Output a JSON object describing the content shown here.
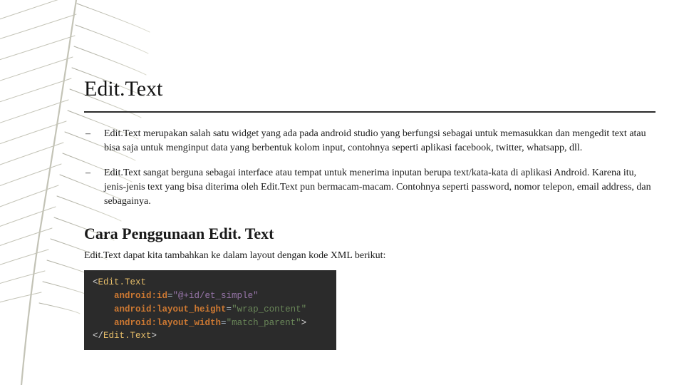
{
  "title": "Edit.Text",
  "bullets": [
    "Edit.Text merupakan salah satu widget yang ada pada android studio yang berfungsi sebagai untuk memasukkan dan mengedit text atau bisa saja untuk menginput data yang berbentuk kolom input, contohnya seperti aplikasi facebook, twitter, whatsapp, dll.",
    "Edit.Text sangat berguna sebagai interface atau tempat untuk menerima inputan berupa text/kata-kata di aplikasi Android. Karena itu, jenis-jenis text yang bisa diterima oleh Edit.Text pun bermacam-macam. Contohnya seperti password, nomor telepon, email address, dan sebagainya."
  ],
  "subheading": "Cara Penggunaan Edit. Text",
  "intro": "Edit.Text dapat kita tambahkan ke dalam layout dengan kode XML berikut:",
  "code": {
    "tag_open": "Edit.Text",
    "attr_id_name": "android:id",
    "attr_id_val": "\"@+id/et_simple\"",
    "attr_h_name": "android:layout_height",
    "attr_h_val": "\"wrap_content\"",
    "attr_w_name": "android:layout_width",
    "attr_w_val": "\"match_parent\"",
    "tag_close": "Edit.Text"
  }
}
